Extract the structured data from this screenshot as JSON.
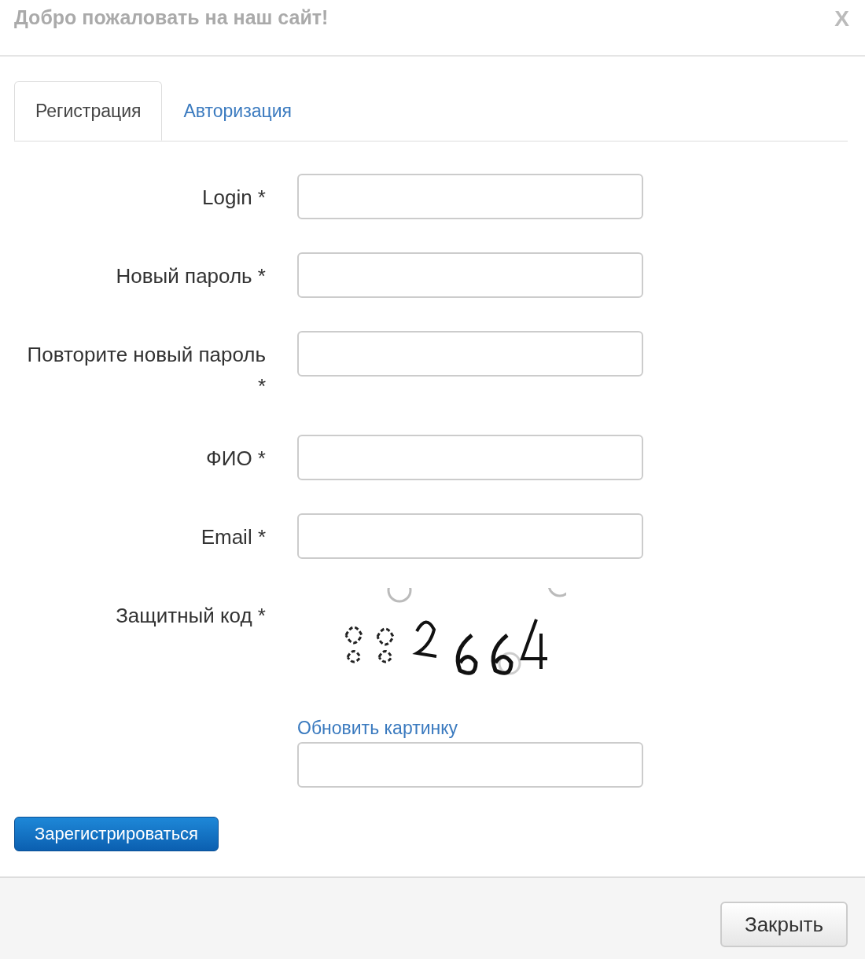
{
  "title": "Добро пожаловать на наш сайт!",
  "close_icon": "X",
  "tabs": [
    {
      "label": "Регистрация",
      "selected": true
    },
    {
      "label": "Авторизация",
      "selected": false
    }
  ],
  "fields": [
    {
      "label": "Login *"
    },
    {
      "label": "Новый пароль *"
    },
    {
      "label": "Повторите новый пароль *"
    },
    {
      "label": "ФИО *"
    },
    {
      "label": "Email *"
    }
  ],
  "captcha": {
    "label": "Защитный код *",
    "refresh_link": "Обновить картинку"
  },
  "submit_button": "Зарегистрироваться",
  "footer_button": "Закрыть"
}
